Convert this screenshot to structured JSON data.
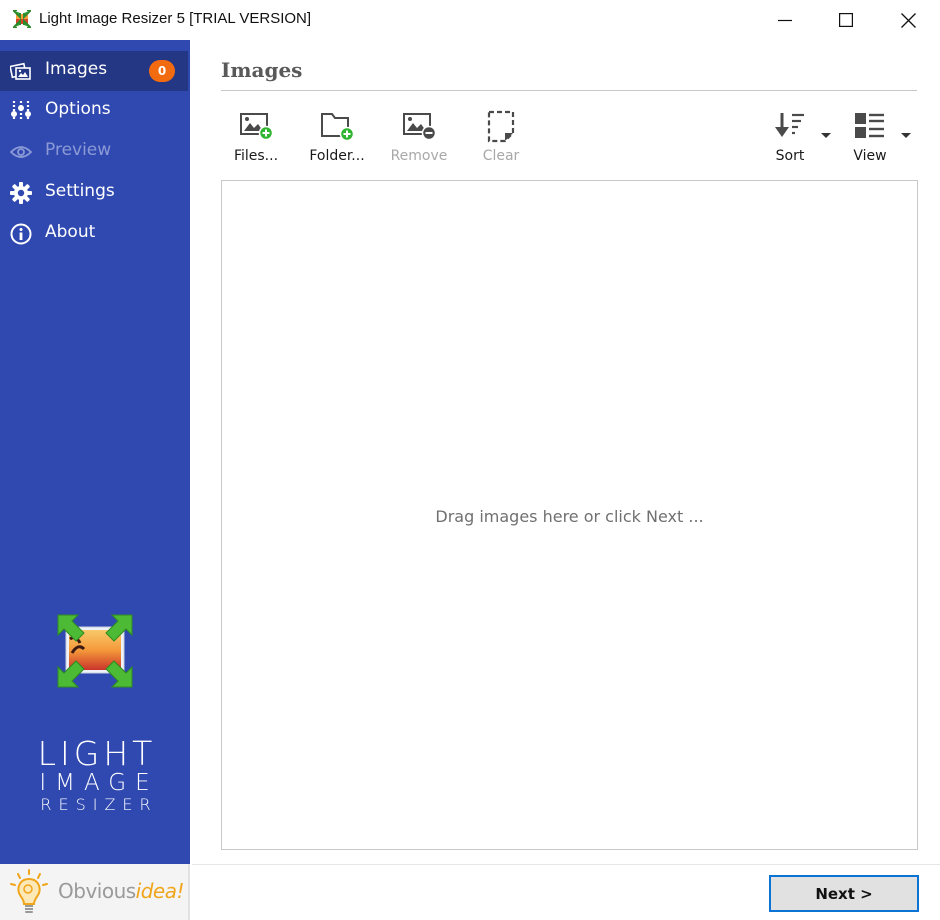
{
  "window": {
    "title": "Light Image Resizer 5  [TRIAL VERSION]",
    "controls": [
      "minimize",
      "maximize",
      "close"
    ]
  },
  "sidebar": {
    "items": [
      {
        "label": "Images",
        "icon": "images-icon",
        "badge": "0",
        "active": true,
        "enabled": true
      },
      {
        "label": "Options",
        "icon": "sliders-icon",
        "active": false,
        "enabled": true
      },
      {
        "label": "Preview",
        "icon": "eye-icon",
        "active": false,
        "enabled": false
      },
      {
        "label": "Settings",
        "icon": "gear-icon",
        "active": false,
        "enabled": true
      },
      {
        "label": "About",
        "icon": "info-icon",
        "active": false,
        "enabled": true
      }
    ],
    "logo": {
      "line1": "LIGHT",
      "line2": "IMAGE",
      "line3": "RESIZER"
    },
    "brand": {
      "part1": "Obvious",
      "part2": "idea!"
    }
  },
  "main": {
    "title": "Images",
    "toolbar": [
      {
        "label": "Files...",
        "icon": "add-image-icon",
        "enabled": true
      },
      {
        "label": "Folder...",
        "icon": "add-folder-icon",
        "enabled": true
      },
      {
        "label": "Remove",
        "icon": "remove-image-icon",
        "enabled": false
      },
      {
        "label": "Clear",
        "icon": "clear-icon",
        "enabled": false
      },
      {
        "label": "Sort",
        "icon": "sort-icon",
        "enabled": true,
        "dropdown": true
      },
      {
        "label": "View",
        "icon": "view-icon",
        "enabled": true,
        "dropdown": true
      }
    ],
    "drop_hint": "Drag images here or click Next ..."
  },
  "footer": {
    "next_label": "Next >"
  },
  "colors": {
    "sidebar_bg": "#3049b0",
    "sidebar_active": "#233784",
    "badge": "#f36b10",
    "accent_green": "#2fb52f",
    "focus_border": "#0a73d4"
  }
}
